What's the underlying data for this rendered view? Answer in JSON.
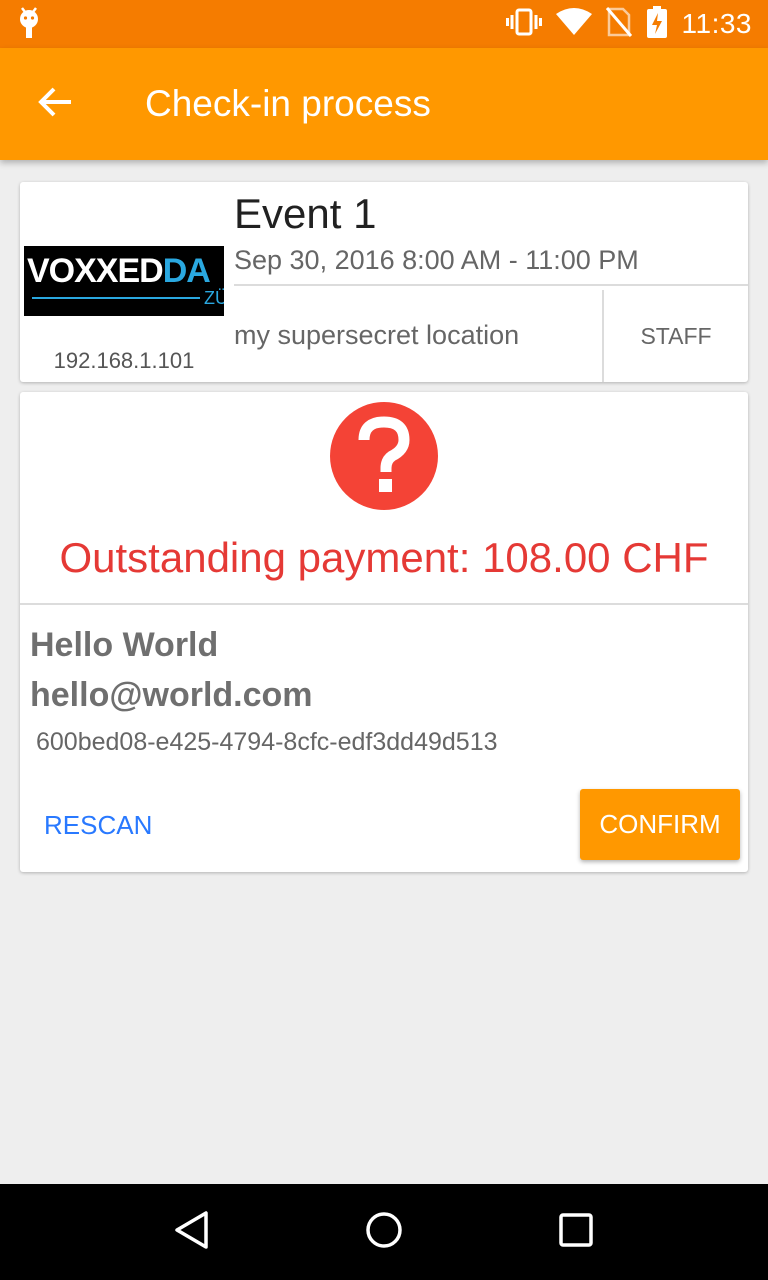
{
  "status_bar": {
    "time": "11:33",
    "icons": [
      "android-debug-icon",
      "vibrate-icon",
      "wifi-icon",
      "no-sim-icon",
      "battery-charging-icon"
    ]
  },
  "app_bar": {
    "title": "Check-in process",
    "back_icon": "arrow-back-icon"
  },
  "event": {
    "logo_text_white": "VOXXED",
    "logo_text_blue": "DA",
    "logo_subtext": "ZÜ",
    "server_ip": "192.168.1.101",
    "name": "Event 1",
    "date": "Sep 30, 2016 8:00 AM - 11:00 PM",
    "location": "my supersecret location",
    "role": "STAFF"
  },
  "checkin": {
    "status_icon": "question-mark-icon",
    "message": "Outstanding payment: 108.00 CHF",
    "attendee_name": "Hello World",
    "attendee_email": "hello@world.com",
    "ticket_uuid": "600bed08-e425-4794-8cfc-edf3dd49d513",
    "rescan_label": "RESCAN",
    "confirm_label": "CONFIRM"
  },
  "colors": {
    "status_bar": "#f57c00",
    "app_bar": "#ff9800",
    "error": "#e53935",
    "link": "#2979ff",
    "accent": "#ff9800"
  },
  "nav_bar": {
    "icons": [
      "back-triangle-icon",
      "home-circle-icon",
      "recents-square-icon"
    ]
  }
}
